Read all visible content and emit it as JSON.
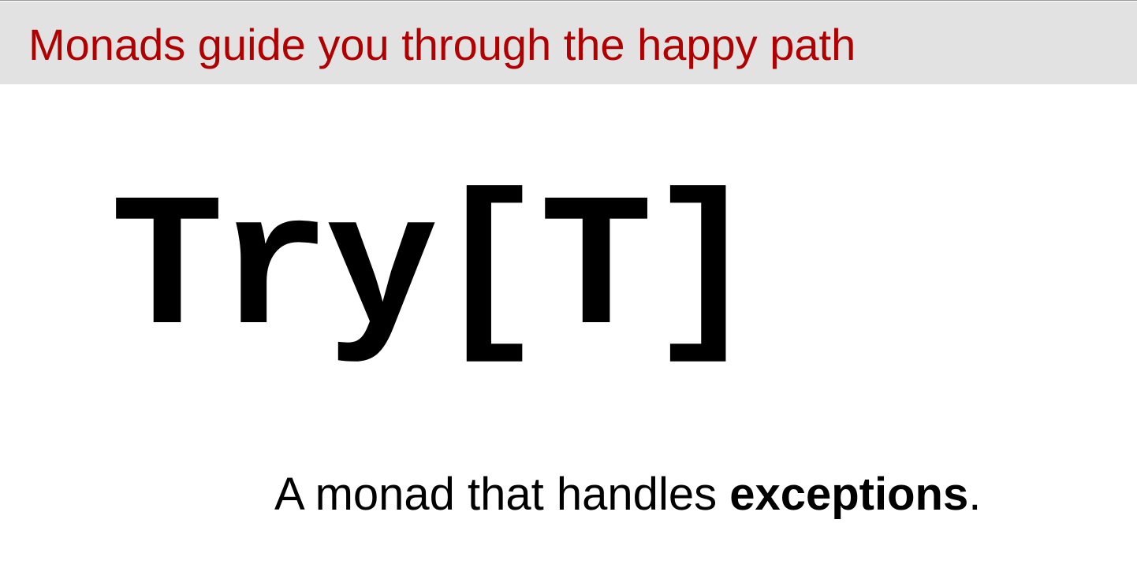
{
  "slide": {
    "title": "Monads guide you through the happy path",
    "code_heading": "Try[T]",
    "caption": {
      "prefix": "A monad that handles ",
      "emphasis": "exceptions",
      "suffix": "."
    },
    "colors": {
      "title_text": "#b00000",
      "title_bar_background": "#e2e2e2",
      "body_text": "#000000",
      "background": "#ffffff"
    }
  }
}
